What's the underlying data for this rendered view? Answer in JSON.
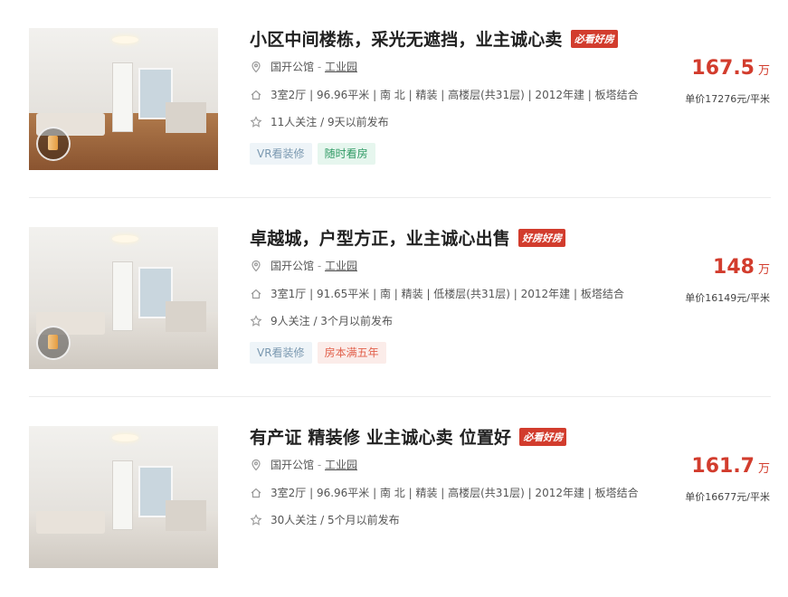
{
  "listings": [
    {
      "title": "小区中间楼栋，采光无遮挡，业主诚心卖",
      "badge": "必看好房",
      "community": "国开公馆",
      "area": "工业园",
      "house_info": "3室2厅 | 96.96平米 | 南 北 | 精装 | 高楼层(共31层) | 2012年建 | 板塔结合",
      "follow_info": "11人关注 / 9天以前发布",
      "tags": [
        "VR看装修",
        "随时看房"
      ],
      "total_price": "167.5",
      "total_unit": "万",
      "unit_price": "单价17276元/平米"
    },
    {
      "title": "卓越城，户型方正，业主诚心出售",
      "badge": "好房好房",
      "community": "国开公馆",
      "area": "工业园",
      "house_info": "3室1厅 | 91.65平米 | 南 | 精装 | 低楼层(共31层) | 2012年建 | 板塔结合",
      "follow_info": "9人关注 / 3个月以前发布",
      "tags": [
        "VR看装修",
        "房本满五年"
      ],
      "total_price": "148",
      "total_unit": "万",
      "unit_price": "单价16149元/平米"
    },
    {
      "title": "有产证 精装修 业主诚心卖 位置好",
      "badge": "必看好房",
      "community": "国开公馆",
      "area": "工业园",
      "house_info": "3室2厅 | 96.96平米 | 南 北 | 精装 | 高楼层(共31层) | 2012年建 | 板塔结合",
      "follow_info": "30人关注 / 5个月以前发布",
      "tags": [],
      "total_price": "161.7",
      "total_unit": "万",
      "unit_price": "单价16677元/平米"
    }
  ],
  "colors": {
    "price_red": "#d23c2d",
    "badge_red": "#d23c2d",
    "tag_vr": "#7a98b0",
    "tag_green": "#2f9a64",
    "tag_red": "#e2604b"
  },
  "icons": [
    "location-pin-icon",
    "house-icon",
    "star-icon",
    "vr-play-icon"
  ]
}
